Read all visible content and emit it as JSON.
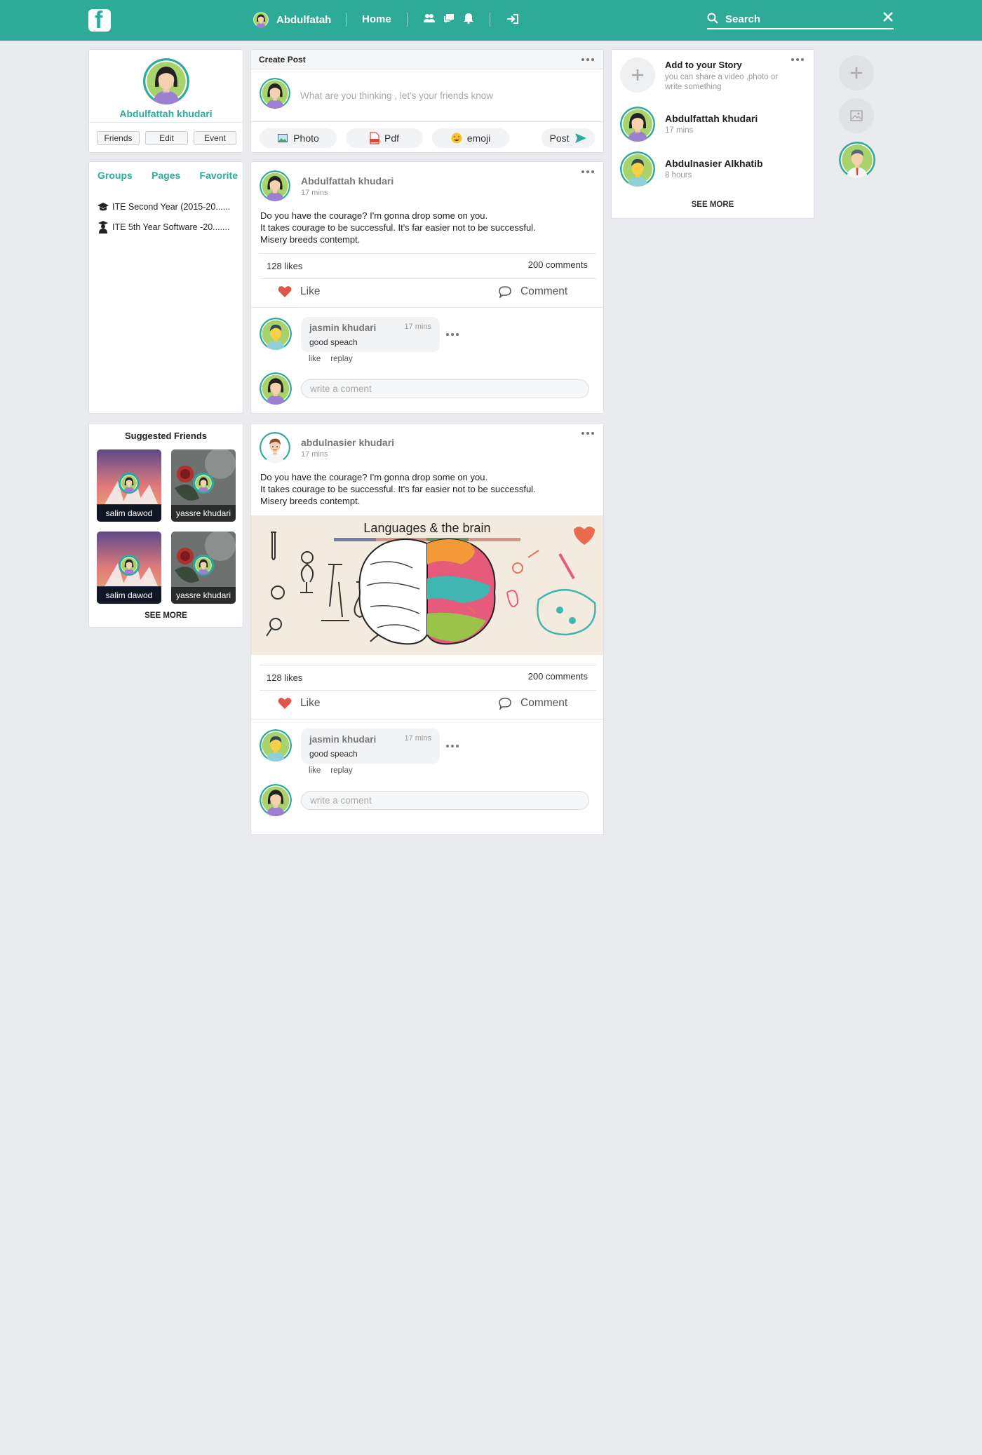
{
  "header": {
    "user_name": "Abdulfatah",
    "home_label": "Home",
    "search_placeholder": "Search"
  },
  "profile": {
    "name": "Abdulfattah khudari",
    "buttons": [
      "Friends",
      "Edit",
      "Event"
    ]
  },
  "groups": {
    "tabs": [
      "Groups",
      "Pages",
      "Favorite"
    ],
    "items": [
      "ITE Second Year (2015-20......",
      "ITE 5th Year Software -20......."
    ]
  },
  "suggested": {
    "title": "Suggested Friends",
    "friends": [
      "salim dawod",
      "yassre khudari",
      "salim dawod",
      "yassre khudari"
    ],
    "see_more": "SEE MORE"
  },
  "create_post": {
    "title": "Create Post",
    "placeholder": "What are you thinking , let's your friends know",
    "actions": [
      "Photo",
      "Pdf",
      "emoji"
    ],
    "post_label": "Post"
  },
  "posts": [
    {
      "author": "Abdulfattah khudari",
      "time": "17 mins",
      "lines": [
        "Do you have the courage? I'm gonna drop some on you.",
        "It takes courage to be successful. It's far easier not to be successful.",
        "Misery breeds contempt."
      ],
      "likes": "128 likes",
      "comments": "200 comments",
      "like_label": "Like",
      "comment_label": "Comment",
      "comment": {
        "name": "jasmin khudari",
        "time": "17 mins",
        "text": "good speach",
        "like": "like",
        "reply": "replay"
      },
      "write_placeholder": "write a coment"
    },
    {
      "author": "abdulnasier khudari",
      "time": "17 mins",
      "lines": [
        "Do you have the courage? I'm gonna drop some on you.",
        "It takes courage to be successful. It's far easier not to be successful.",
        "Misery breeds contempt."
      ],
      "image_title": "Languages & the brain",
      "likes": "128 likes",
      "comments": "200 comments",
      "like_label": "Like",
      "comment_label": "Comment",
      "comment": {
        "name": "jasmin khudari",
        "time": "17 mins",
        "text": "good speach",
        "like": "like",
        "reply": "replay"
      },
      "write_placeholder": "write a coment"
    }
  ],
  "stories": {
    "add_title": "Add to your Story",
    "add_sub": "you can share a video ,photo or write something",
    "items": [
      {
        "name": "Abdulfattah khudari",
        "time": "17 mins"
      },
      {
        "name": "Abdulnasier Alkhatib",
        "time": "8 hours"
      }
    ],
    "see_more": "SEE MORE"
  },
  "colors": {
    "brand": "#2dab98",
    "background": "#e9ebee",
    "like": "#e0554a"
  },
  "icons": [
    "facebook-logo-icon",
    "friends-icon",
    "messages-icon",
    "bell-icon",
    "logout-icon",
    "search-icon",
    "close-icon",
    "more-dots-icon",
    "photo-icon",
    "pdf-icon",
    "emoji-icon",
    "send-icon",
    "heart-icon",
    "comment-icon",
    "plus-icon",
    "image-icon"
  ]
}
